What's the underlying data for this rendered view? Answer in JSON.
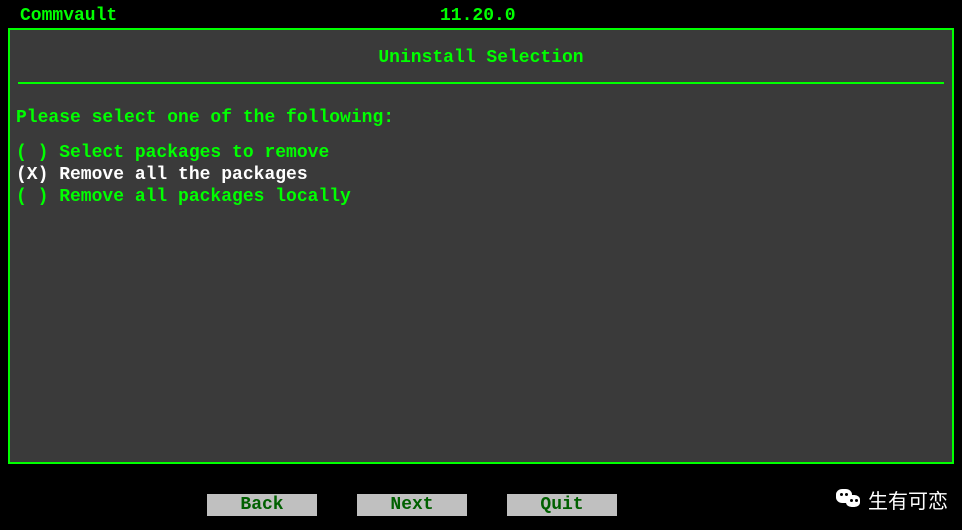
{
  "header": {
    "app_name": "Commvault",
    "version": "11.20.0"
  },
  "panel": {
    "title": "Uninstall Selection",
    "prompt": "Please select one of the following:"
  },
  "options": [
    {
      "label": "Select packages to remove",
      "selected": false
    },
    {
      "label": "Remove all the packages",
      "selected": true
    },
    {
      "label": "Remove all packages locally",
      "selected": false
    }
  ],
  "buttons": {
    "back": "Back",
    "next": "Next",
    "quit": "Quit"
  },
  "watermark": {
    "text": "生有可恋"
  }
}
